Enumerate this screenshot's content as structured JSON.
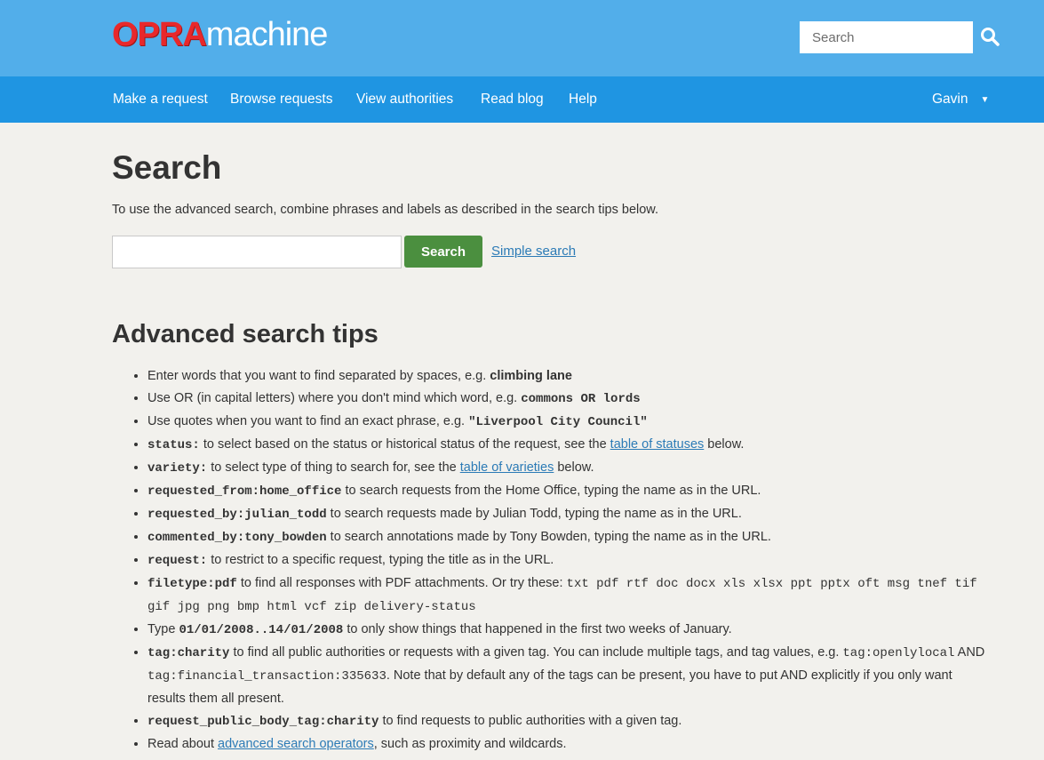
{
  "header": {
    "logo_part1": "OPRA",
    "logo_part2": "machine",
    "search_placeholder": "Search",
    "search_icon": "magnifier-icon"
  },
  "nav": {
    "items": [
      "Make a request",
      "Browse requests",
      "View authorities",
      "Read blog",
      "Help"
    ],
    "user": "Gavin",
    "user_caret": "▼"
  },
  "page": {
    "title": "Search",
    "intro": "To use the advanced search, combine phrases and labels as described in the search tips below.",
    "search_button": "Search",
    "simple_search_link": "Simple search",
    "tips_heading": "Advanced search tips"
  },
  "tips": {
    "t1_text": "Enter words that you want to find separated by spaces, e.g. ",
    "t1_example": "climbing lane",
    "t2_text": "Use OR (in capital letters) where you don't mind which word, e.g. ",
    "t2_example": "commons OR lords",
    "t3_text": "Use quotes when you want to find an exact phrase, e.g. ",
    "t3_example": "\"Liverpool City Council\"",
    "t4_code": "status:",
    "t4_text": " to select based on the status or historical status of the request, see the ",
    "t4_link": "table of statuses",
    "t4_after": " below.",
    "t5_code": "variety:",
    "t5_text": " to select type of thing to search for, see the ",
    "t5_link": "table of varieties",
    "t5_after": " below.",
    "t6_code": "requested_from:home_office",
    "t6_text": " to search requests from the Home Office, typing the name as in the URL.",
    "t7_code": "requested_by:julian_todd",
    "t7_text": " to search requests made by Julian Todd, typing the name as in the URL.",
    "t8_code": "commented_by:tony_bowden",
    "t8_text": " to search annotations made by Tony Bowden, typing the name as in the URL.",
    "t9_code": "request:",
    "t9_text": " to restrict to a specific request, typing the title as in the URL.",
    "t10_code": "filetype:pdf",
    "t10_text": " to find all responses with PDF attachments. Or try these: ",
    "t10_types": "txt pdf rtf doc docx xls xlsx ppt pptx oft msg tnef tif gif jpg png bmp html vcf zip delivery-status",
    "t11_text": "Type ",
    "t11_code": "01/01/2008..14/01/2008",
    "t11_after": " to only show things that happened in the first two weeks of January.",
    "t12_code": "tag:charity",
    "t12_text": " to find all public authorities or requests with a given tag. You can include multiple tags, and tag values, e.g. ",
    "t12_ex1": "tag:openlylocal",
    "t12_and": " AND ",
    "t12_ex2": "tag:financial_transaction:335633",
    "t12_after": ". Note that by default any of the tags can be present, you have to put AND explicitly if you only want results them all present.",
    "t13_code": "request_public_body_tag:charity",
    "t13_text": " to find requests to public authorities with a given tag.",
    "t14_text": "Read about ",
    "t14_link": "advanced search operators",
    "t14_after": ", such as proximity and wildcards."
  },
  "colors": {
    "topbar": "#52aeea",
    "navbar": "#1f95e2",
    "logo_red": "#e8282b",
    "button_green": "#4b8f3f",
    "link": "#2c7bb6",
    "background": "#f2f1ed"
  }
}
